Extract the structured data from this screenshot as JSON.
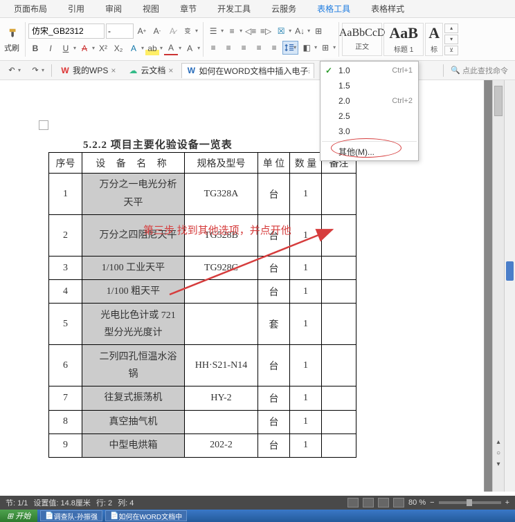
{
  "menu": {
    "tabs": [
      "页面布局",
      "引用",
      "审阅",
      "视图",
      "章节",
      "开发工具",
      "云服务",
      "表格工具",
      "表格样式"
    ]
  },
  "toolbar": {
    "format_painter": "式刷",
    "font_name": "仿宋_GB2312",
    "font_size": "-",
    "style_body_preview": "AaBbCcD",
    "style_body_label": "正文",
    "style_h1_preview": "AaB",
    "style_h1_label": "标题 1",
    "style_h_preview": "A",
    "style_h_label": "标"
  },
  "secbar": {
    "mywps": "我的WPS",
    "yunwendang": "云文档",
    "doc_tab": "如何在WORD文档中插入电子表格",
    "search_placeholder": "点此查找命令"
  },
  "line_spacing_menu": {
    "items": [
      {
        "label": "1.0",
        "shortcut": "Ctrl+1",
        "checked": true
      },
      {
        "label": "1.5",
        "shortcut": ""
      },
      {
        "label": "2.0",
        "shortcut": "Ctrl+2"
      },
      {
        "label": "2.5",
        "shortcut": ""
      },
      {
        "label": "3.0",
        "shortcut": ""
      }
    ],
    "other": "其他(M)..."
  },
  "annotation": {
    "step_text": "第三步 找到其他选项，并点开他"
  },
  "document": {
    "section_title": "5.2.2 项目主要化验设备一览表",
    "headers": {
      "num": "序号",
      "name": "设 备 名 称",
      "spec": "规格及型号",
      "unit": "单 位",
      "qty": "数 量",
      "note": "备注"
    },
    "rows": [
      {
        "num": "1",
        "name": "　万分之一电光分析天平",
        "spec": "TG328A",
        "unit": "台",
        "qty": "1",
        "note": "",
        "tall": true
      },
      {
        "num": "2",
        "name": "　万分之四阻尼天平",
        "spec": "TG528B",
        "unit": "台",
        "qty": "1",
        "note": "",
        "tall": true
      },
      {
        "num": "3",
        "name": "1/100 工业天平",
        "spec": "TG928C",
        "unit": "台",
        "qty": "1",
        "note": ""
      },
      {
        "num": "4",
        "name": "1/100  粗天平",
        "spec": "",
        "unit": "台",
        "qty": "1",
        "note": ""
      },
      {
        "num": "5",
        "name": "　光电比色计或 721型分光光度计",
        "spec": "",
        "unit": "套",
        "qty": "1",
        "note": "",
        "tall": true
      },
      {
        "num": "6",
        "name": "　二列四孔恒温水浴锅",
        "spec": "HH·S21-N14",
        "unit": "台",
        "qty": "1",
        "note": "",
        "tall": true
      },
      {
        "num": "7",
        "name": "往复式振荡机",
        "spec": "HY-2",
        "unit": "台",
        "qty": "1",
        "note": ""
      },
      {
        "num": "8",
        "name": "真空抽气机",
        "spec": "",
        "unit": "台",
        "qty": "1",
        "note": ""
      },
      {
        "num": "9",
        "name": "中型电烘箱",
        "spec": "202-2",
        "unit": "台",
        "qty": "1",
        "note": ""
      }
    ]
  },
  "status": {
    "section": "节: 1/1",
    "setval": "设置值: 14.8厘米",
    "line": "行: 2",
    "col": "列: 4",
    "zoom": "80 %"
  },
  "taskbar": {
    "start": "开始",
    "items": [
      "调查队-孙振强",
      "如何在WORD文档中"
    ]
  }
}
